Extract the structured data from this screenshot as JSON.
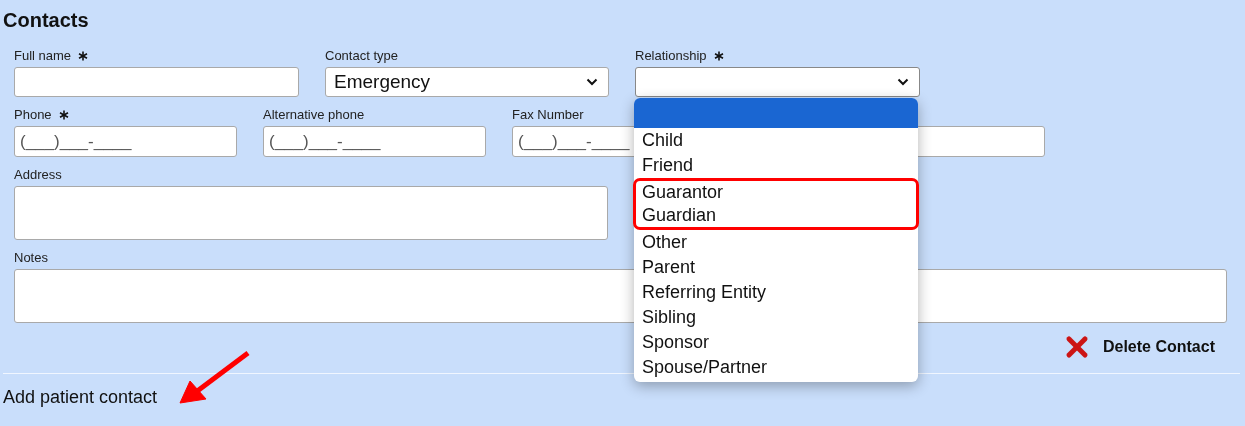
{
  "section": {
    "title": "Contacts"
  },
  "rows": [
    [
      {
        "kind": "text",
        "label": "Full name",
        "required": true
      },
      {
        "kind": "select",
        "label": "Contact type",
        "required": false,
        "value": "Emergency"
      },
      {
        "kind": "select",
        "label": "Relationship",
        "required": true,
        "open": true
      }
    ],
    [
      {
        "kind": "phone",
        "label": "Phone",
        "required": true,
        "placeholder": "(___)___-____"
      },
      {
        "kind": "phone",
        "label": "Alternative phone",
        "required": false,
        "placeholder": "(___)___-____"
      },
      {
        "kind": "phone",
        "label": "Fax Number",
        "required": false,
        "placeholder": "(___)___-____"
      }
    ],
    [
      {
        "kind": "textarea",
        "label": "Address",
        "required": false
      }
    ],
    [
      {
        "kind": "textarea",
        "label": "Notes",
        "required": false
      }
    ]
  ],
  "delete_button": {
    "label": "Delete Contact"
  },
  "add_contact": {
    "label": "Add patient contact",
    "arrow": true
  },
  "dropdown": {
    "options": [
      {
        "kind": "blank",
        "selected": true,
        "boxed": false
      },
      {
        "label": "Child",
        "selected": false,
        "boxed": false
      },
      {
        "label": "Friend",
        "selected": false,
        "boxed": false
      },
      {
        "label": "Guarantor",
        "selected": false,
        "boxed": true
      },
      {
        "label": "Guardian",
        "selected": false,
        "boxed": true
      },
      {
        "label": "Other",
        "selected": false,
        "boxed": false
      },
      {
        "label": "Parent",
        "selected": false,
        "boxed": false
      },
      {
        "label": "Referring Entity",
        "selected": false,
        "boxed": false
      },
      {
        "label": "Sibling",
        "selected": false,
        "boxed": false
      },
      {
        "label": "Sponsor",
        "selected": false,
        "boxed": false
      },
      {
        "label": "Spouse/Partner",
        "selected": false,
        "boxed": false
      }
    ]
  }
}
